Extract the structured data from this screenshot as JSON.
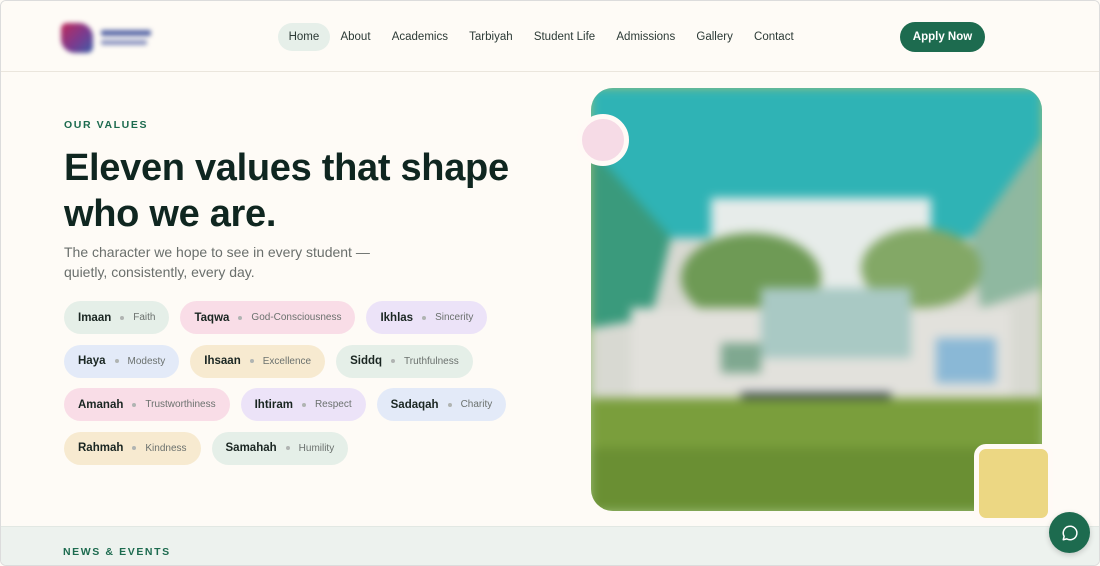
{
  "header": {
    "nav": [
      "Home",
      "About",
      "Academics",
      "Tarbiyah",
      "Student Life",
      "Admissions",
      "Gallery",
      "Contact"
    ],
    "active_nav": "Home",
    "apply_label": "Apply Now"
  },
  "hero": {
    "eyebrow": "OUR VALUES",
    "title_line1": "Eleven values that shape",
    "title_line2": "who we are.",
    "subtitle": "The character we hope to see in every student — quietly, consistently, every day.",
    "values": [
      {
        "name": "Imaan",
        "meaning": "Faith",
        "color": "#e5efe8"
      },
      {
        "name": "Taqwa",
        "meaning": "God-Consciousness",
        "color": "#f9dde7"
      },
      {
        "name": "Ikhlas",
        "meaning": "Sincerity",
        "color": "#ece3f8"
      },
      {
        "name": "Haya",
        "meaning": "Modesty",
        "color": "#e3eaf8"
      },
      {
        "name": "Ihsaan",
        "meaning": "Excellence",
        "color": "#f7ead0"
      },
      {
        "name": "Siddq",
        "meaning": "Truthfulness",
        "color": "#e5efe8"
      },
      {
        "name": "Amanah",
        "meaning": "Trustworthiness",
        "color": "#f9dde7"
      },
      {
        "name": "Ihtiram",
        "meaning": "Respect",
        "color": "#ece3f8"
      },
      {
        "name": "Sadaqah",
        "meaning": "Charity",
        "color": "#e3eaf8"
      },
      {
        "name": "Rahmah",
        "meaning": "Kindness",
        "color": "#f7ead0"
      },
      {
        "name": "Samahah",
        "meaning": "Humility",
        "color": "#e5efe8"
      }
    ]
  },
  "news": {
    "label": "NEWS & EVENTS"
  },
  "icons": {
    "chat": "chat-bubble-icon",
    "logo": "school-logo"
  },
  "colors": {
    "brand": "#1d6b4f",
    "background": "#fefbf6"
  }
}
